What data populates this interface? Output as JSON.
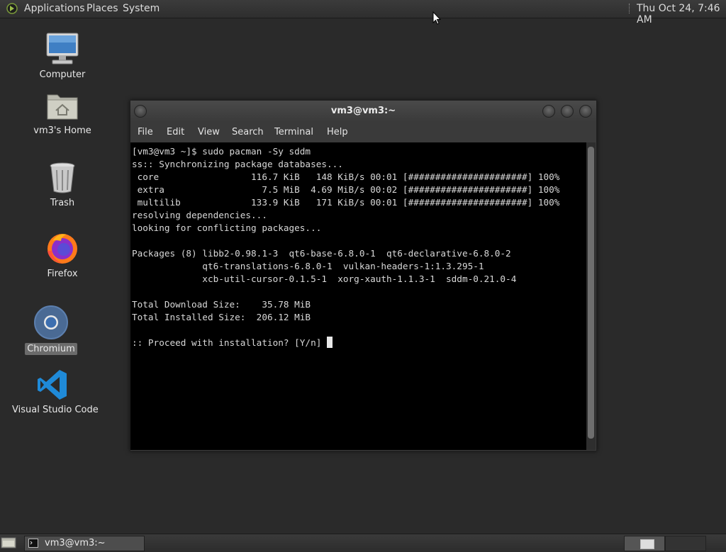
{
  "top_panel": {
    "menus": [
      "Applications",
      "Places",
      "System"
    ],
    "clock": "Thu Oct 24,  7:46 AM"
  },
  "desktop_icons": [
    {
      "label": "Computer",
      "icon": "computer-icon"
    },
    {
      "label": "vm3's Home",
      "icon": "home-folder-icon"
    },
    {
      "label": "Trash",
      "icon": "trash-icon"
    },
    {
      "label": "Firefox",
      "icon": "firefox-icon"
    },
    {
      "label": "Chromium",
      "icon": "chromium-icon"
    },
    {
      "label": "Visual Studio Code",
      "icon": "vscode-icon"
    }
  ],
  "window": {
    "title": "vm3@vm3:~",
    "menus": [
      "File",
      "Edit",
      "View",
      "Search",
      "Terminal",
      "Help"
    ],
    "terminal_lines": [
      "[vm3@vm3 ~]$ sudo pacman -Sy sddm",
      "ss:: Synchronizing package databases...",
      " core                 116.7 KiB   148 KiB/s 00:01 [######################] 100%",
      " extra                  7.5 MiB  4.69 MiB/s 00:02 [######################] 100%",
      " multilib             133.9 KiB   171 KiB/s 00:01 [######################] 100%",
      "resolving dependencies...",
      "looking for conflicting packages...",
      "",
      "Packages (8) libb2-0.98.1-3  qt6-base-6.8.0-1  qt6-declarative-6.8.0-2",
      "             qt6-translations-6.8.0-1  vulkan-headers-1:1.3.295-1",
      "             xcb-util-cursor-0.1.5-1  xorg-xauth-1.1.3-1  sddm-0.21.0-4",
      "",
      "Total Download Size:    35.78 MiB",
      "Total Installed Size:  206.12 MiB",
      "",
      ":: Proceed with installation? [Y/n] "
    ]
  },
  "taskbar": {
    "task_label": "vm3@vm3:~"
  }
}
